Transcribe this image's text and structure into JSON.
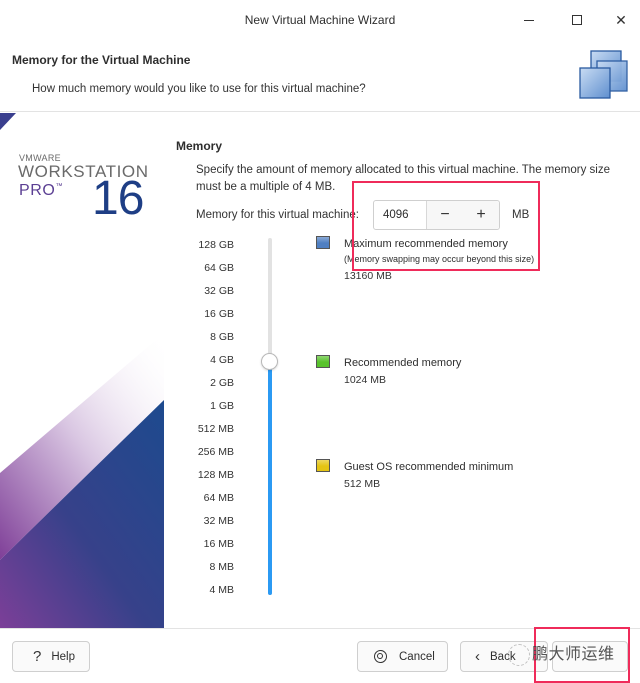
{
  "window": {
    "title": "New Virtual Machine Wizard",
    "controls": {
      "minimize": "minimize",
      "maximize": "maximize",
      "close": "✕"
    }
  },
  "header": {
    "title": "Memory for the Virtual Machine",
    "subtitle": "How much memory would you like to use for this virtual machine?",
    "icon": "virtual-machines-icon"
  },
  "branding": {
    "vendor": "VMWARE",
    "product": "WORKSTATION",
    "edition": "PRO",
    "trademark": "™",
    "version": "16"
  },
  "memory": {
    "section_title": "Memory",
    "description": "Specify the amount of memory allocated to this virtual machine. The memory size must be a multiple of 4 MB.",
    "field_label": "Memory for this virtual machine:",
    "value": "4096",
    "unit": "MB",
    "decrement": "−",
    "increment": "+",
    "slider": {
      "ticks": [
        "128 GB",
        "64 GB",
        "32 GB",
        "16 GB",
        "8 GB",
        "4 GB",
        "2 GB",
        "1 GB",
        "512 MB",
        "256 MB",
        "128 MB",
        "64 MB",
        "32 MB",
        "16 MB",
        "8 MB",
        "4 MB"
      ],
      "selected_tick": "4 GB"
    },
    "legend": [
      {
        "title": "Maximum recommended memory",
        "note": "(Memory swapping may occur beyond this size)",
        "value": "13160 MB",
        "color": "#4f7fc2"
      },
      {
        "title": "Recommended memory",
        "note": "",
        "value": "1024 MB",
        "color": "#58c22c"
      },
      {
        "title": "Guest OS recommended minimum",
        "note": "",
        "value": "512 MB",
        "color": "#e4c414"
      }
    ]
  },
  "footer": {
    "help": "Help",
    "cancel": "Cancel",
    "back": "Back",
    "watermark": "鹏大师运维"
  },
  "colors": {
    "accent": "#2b9af3",
    "highlight": "#ef2b5a",
    "brand_blue": "#1e3e85",
    "brand_purple": "#5b3f93"
  }
}
